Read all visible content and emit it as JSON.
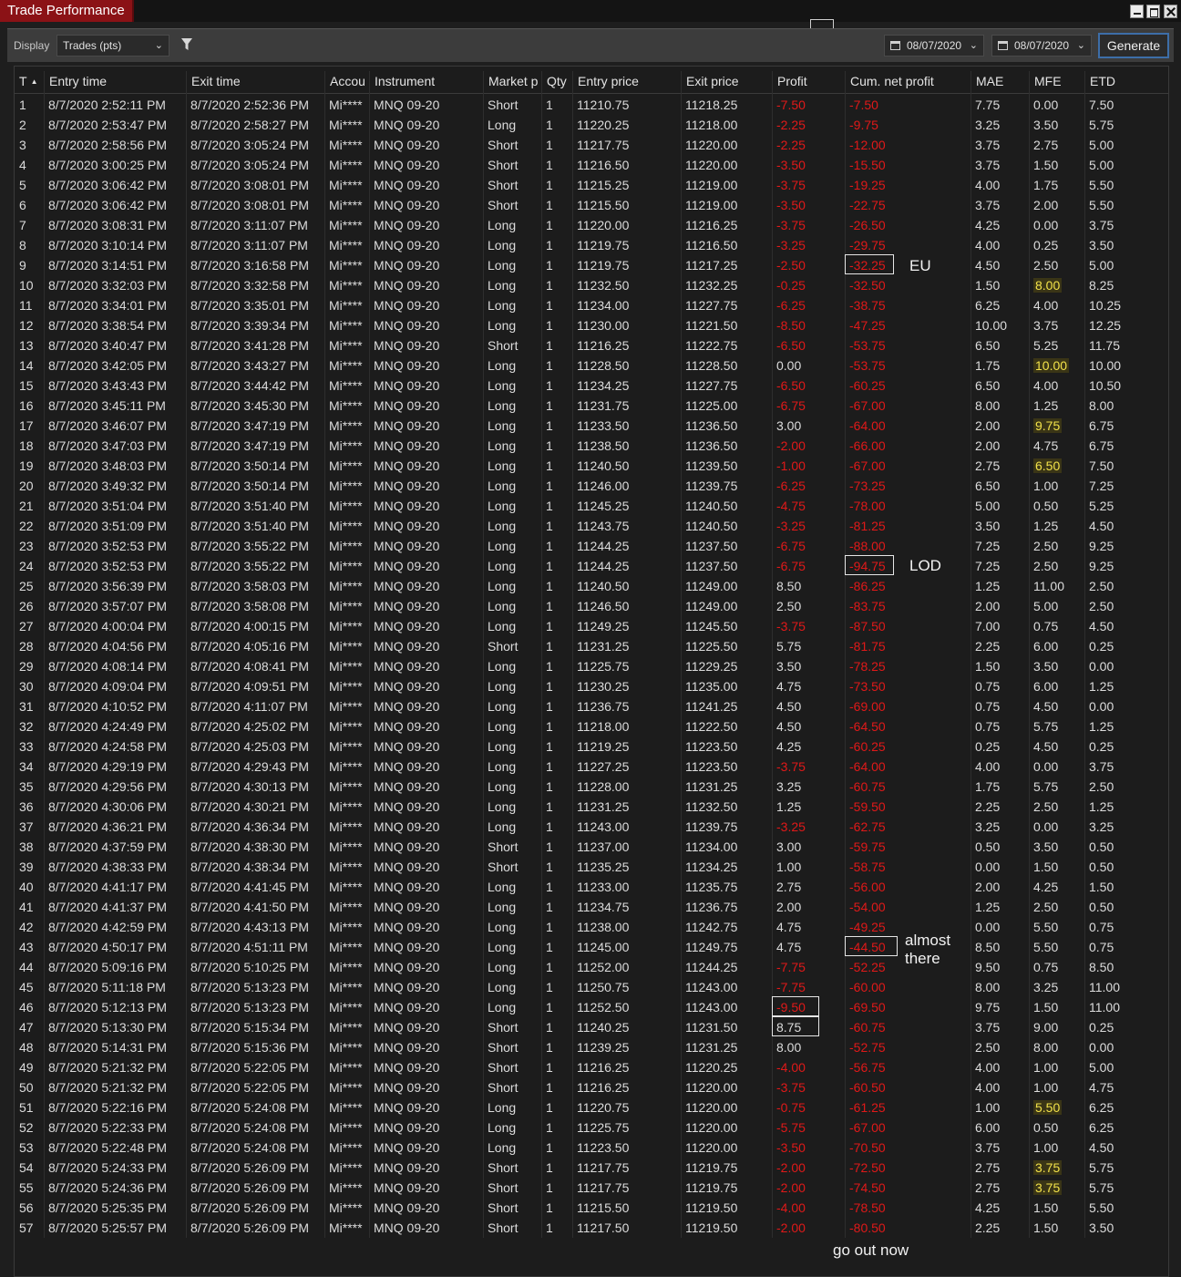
{
  "window": {
    "title": "Trade Performance"
  },
  "toolbar": {
    "display_label": "Display",
    "display_value": "Trades (pts)",
    "from_date": "08/07/2020",
    "to_date": "08/07/2020",
    "generate_label": "Generate"
  },
  "columns": [
    "T",
    "Entry time",
    "Exit time",
    "Accou",
    "Instrument",
    "Market p",
    "Qty",
    "Entry price",
    "Exit price",
    "Profit",
    "Cum. net profit",
    "MAE",
    "MFE",
    "ETD"
  ],
  "rows": [
    [
      "1",
      "8/7/2020 2:52:11 PM",
      "8/7/2020 2:52:36 PM",
      "Mi****",
      "MNQ 09-20",
      "Short",
      "1",
      "11210.75",
      "11218.25",
      "-7.50",
      "-7.50",
      "7.75",
      "0.00",
      "7.50"
    ],
    [
      "2",
      "8/7/2020 2:53:47 PM",
      "8/7/2020 2:58:27 PM",
      "Mi****",
      "MNQ 09-20",
      "Long",
      "1",
      "11220.25",
      "11218.00",
      "-2.25",
      "-9.75",
      "3.25",
      "3.50",
      "5.75"
    ],
    [
      "3",
      "8/7/2020 2:58:56 PM",
      "8/7/2020 3:05:24 PM",
      "Mi****",
      "MNQ 09-20",
      "Short",
      "1",
      "11217.75",
      "11220.00",
      "-2.25",
      "-12.00",
      "3.75",
      "2.75",
      "5.00"
    ],
    [
      "4",
      "8/7/2020 3:00:25 PM",
      "8/7/2020 3:05:24 PM",
      "Mi****",
      "MNQ 09-20",
      "Short",
      "1",
      "11216.50",
      "11220.00",
      "-3.50",
      "-15.50",
      "3.75",
      "1.50",
      "5.00"
    ],
    [
      "5",
      "8/7/2020 3:06:42 PM",
      "8/7/2020 3:08:01 PM",
      "Mi****",
      "MNQ 09-20",
      "Short",
      "1",
      "11215.25",
      "11219.00",
      "-3.75",
      "-19.25",
      "4.00",
      "1.75",
      "5.50"
    ],
    [
      "6",
      "8/7/2020 3:06:42 PM",
      "8/7/2020 3:08:01 PM",
      "Mi****",
      "MNQ 09-20",
      "Short",
      "1",
      "11215.50",
      "11219.00",
      "-3.50",
      "-22.75",
      "3.75",
      "2.00",
      "5.50"
    ],
    [
      "7",
      "8/7/2020 3:08:31 PM",
      "8/7/2020 3:11:07 PM",
      "Mi****",
      "MNQ 09-20",
      "Long",
      "1",
      "11220.00",
      "11216.25",
      "-3.75",
      "-26.50",
      "4.25",
      "0.00",
      "3.75"
    ],
    [
      "8",
      "8/7/2020 3:10:14 PM",
      "8/7/2020 3:11:07 PM",
      "Mi****",
      "MNQ 09-20",
      "Long",
      "1",
      "11219.75",
      "11216.50",
      "-3.25",
      "-29.75",
      "4.00",
      "0.25",
      "3.50"
    ],
    [
      "9",
      "8/7/2020 3:14:51 PM",
      "8/7/2020 3:16:58 PM",
      "Mi****",
      "MNQ 09-20",
      "Long",
      "1",
      "11219.75",
      "11217.25",
      "-2.50",
      "-32.25",
      "4.50",
      "2.50",
      "5.00"
    ],
    [
      "10",
      "8/7/2020 3:32:03 PM",
      "8/7/2020 3:32:58 PM",
      "Mi****",
      "MNQ 09-20",
      "Long",
      "1",
      "11232.50",
      "11232.25",
      "-0.25",
      "-32.50",
      "1.50",
      "8.00",
      "8.25"
    ],
    [
      "11",
      "8/7/2020 3:34:01 PM",
      "8/7/2020 3:35:01 PM",
      "Mi****",
      "MNQ 09-20",
      "Long",
      "1",
      "11234.00",
      "11227.75",
      "-6.25",
      "-38.75",
      "6.25",
      "4.00",
      "10.25"
    ],
    [
      "12",
      "8/7/2020 3:38:54 PM",
      "8/7/2020 3:39:34 PM",
      "Mi****",
      "MNQ 09-20",
      "Long",
      "1",
      "11230.00",
      "11221.50",
      "-8.50",
      "-47.25",
      "10.00",
      "3.75",
      "12.25"
    ],
    [
      "13",
      "8/7/2020 3:40:47 PM",
      "8/7/2020 3:41:28 PM",
      "Mi****",
      "MNQ 09-20",
      "Short",
      "1",
      "11216.25",
      "11222.75",
      "-6.50",
      "-53.75",
      "6.50",
      "5.25",
      "11.75"
    ],
    [
      "14",
      "8/7/2020 3:42:05 PM",
      "8/7/2020 3:43:27 PM",
      "Mi****",
      "MNQ 09-20",
      "Long",
      "1",
      "11228.50",
      "11228.50",
      "0.00",
      "-53.75",
      "1.75",
      "10.00",
      "10.00"
    ],
    [
      "15",
      "8/7/2020 3:43:43 PM",
      "8/7/2020 3:44:42 PM",
      "Mi****",
      "MNQ 09-20",
      "Long",
      "1",
      "11234.25",
      "11227.75",
      "-6.50",
      "-60.25",
      "6.50",
      "4.00",
      "10.50"
    ],
    [
      "16",
      "8/7/2020 3:45:11 PM",
      "8/7/2020 3:45:30 PM",
      "Mi****",
      "MNQ 09-20",
      "Long",
      "1",
      "11231.75",
      "11225.00",
      "-6.75",
      "-67.00",
      "8.00",
      "1.25",
      "8.00"
    ],
    [
      "17",
      "8/7/2020 3:46:07 PM",
      "8/7/2020 3:47:19 PM",
      "Mi****",
      "MNQ 09-20",
      "Long",
      "1",
      "11233.50",
      "11236.50",
      "3.00",
      "-64.00",
      "2.00",
      "9.75",
      "6.75"
    ],
    [
      "18",
      "8/7/2020 3:47:03 PM",
      "8/7/2020 3:47:19 PM",
      "Mi****",
      "MNQ 09-20",
      "Long",
      "1",
      "11238.50",
      "11236.50",
      "-2.00",
      "-66.00",
      "2.00",
      "4.75",
      "6.75"
    ],
    [
      "19",
      "8/7/2020 3:48:03 PM",
      "8/7/2020 3:50:14 PM",
      "Mi****",
      "MNQ 09-20",
      "Long",
      "1",
      "11240.50",
      "11239.50",
      "-1.00",
      "-67.00",
      "2.75",
      "6.50",
      "7.50"
    ],
    [
      "20",
      "8/7/2020 3:49:32 PM",
      "8/7/2020 3:50:14 PM",
      "Mi****",
      "MNQ 09-20",
      "Long",
      "1",
      "11246.00",
      "11239.75",
      "-6.25",
      "-73.25",
      "6.50",
      "1.00",
      "7.25"
    ],
    [
      "21",
      "8/7/2020 3:51:04 PM",
      "8/7/2020 3:51:40 PM",
      "Mi****",
      "MNQ 09-20",
      "Long",
      "1",
      "11245.25",
      "11240.50",
      "-4.75",
      "-78.00",
      "5.00",
      "0.50",
      "5.25"
    ],
    [
      "22",
      "8/7/2020 3:51:09 PM",
      "8/7/2020 3:51:40 PM",
      "Mi****",
      "MNQ 09-20",
      "Long",
      "1",
      "11243.75",
      "11240.50",
      "-3.25",
      "-81.25",
      "3.50",
      "1.25",
      "4.50"
    ],
    [
      "23",
      "8/7/2020 3:52:53 PM",
      "8/7/2020 3:55:22 PM",
      "Mi****",
      "MNQ 09-20",
      "Long",
      "1",
      "11244.25",
      "11237.50",
      "-6.75",
      "-88.00",
      "7.25",
      "2.50",
      "9.25"
    ],
    [
      "24",
      "8/7/2020 3:52:53 PM",
      "8/7/2020 3:55:22 PM",
      "Mi****",
      "MNQ 09-20",
      "Long",
      "1",
      "11244.25",
      "11237.50",
      "-6.75",
      "-94.75",
      "7.25",
      "2.50",
      "9.25"
    ],
    [
      "25",
      "8/7/2020 3:56:39 PM",
      "8/7/2020 3:58:03 PM",
      "Mi****",
      "MNQ 09-20",
      "Long",
      "1",
      "11240.50",
      "11249.00",
      "8.50",
      "-86.25",
      "1.25",
      "11.00",
      "2.50"
    ],
    [
      "26",
      "8/7/2020 3:57:07 PM",
      "8/7/2020 3:58:08 PM",
      "Mi****",
      "MNQ 09-20",
      "Long",
      "1",
      "11246.50",
      "11249.00",
      "2.50",
      "-83.75",
      "2.00",
      "5.00",
      "2.50"
    ],
    [
      "27",
      "8/7/2020 4:00:04 PM",
      "8/7/2020 4:00:15 PM",
      "Mi****",
      "MNQ 09-20",
      "Long",
      "1",
      "11249.25",
      "11245.50",
      "-3.75",
      "-87.50",
      "7.00",
      "0.75",
      "4.50"
    ],
    [
      "28",
      "8/7/2020 4:04:56 PM",
      "8/7/2020 4:05:16 PM",
      "Mi****",
      "MNQ 09-20",
      "Short",
      "1",
      "11231.25",
      "11225.50",
      "5.75",
      "-81.75",
      "2.25",
      "6.00",
      "0.25"
    ],
    [
      "29",
      "8/7/2020 4:08:14 PM",
      "8/7/2020 4:08:41 PM",
      "Mi****",
      "MNQ 09-20",
      "Long",
      "1",
      "11225.75",
      "11229.25",
      "3.50",
      "-78.25",
      "1.50",
      "3.50",
      "0.00"
    ],
    [
      "30",
      "8/7/2020 4:09:04 PM",
      "8/7/2020 4:09:51 PM",
      "Mi****",
      "MNQ 09-20",
      "Long",
      "1",
      "11230.25",
      "11235.00",
      "4.75",
      "-73.50",
      "0.75",
      "6.00",
      "1.25"
    ],
    [
      "31",
      "8/7/2020 4:10:52 PM",
      "8/7/2020 4:11:07 PM",
      "Mi****",
      "MNQ 09-20",
      "Long",
      "1",
      "11236.75",
      "11241.25",
      "4.50",
      "-69.00",
      "0.75",
      "4.50",
      "0.00"
    ],
    [
      "32",
      "8/7/2020 4:24:49 PM",
      "8/7/2020 4:25:02 PM",
      "Mi****",
      "MNQ 09-20",
      "Long",
      "1",
      "11218.00",
      "11222.50",
      "4.50",
      "-64.50",
      "0.75",
      "5.75",
      "1.25"
    ],
    [
      "33",
      "8/7/2020 4:24:58 PM",
      "8/7/2020 4:25:03 PM",
      "Mi****",
      "MNQ 09-20",
      "Long",
      "1",
      "11219.25",
      "11223.50",
      "4.25",
      "-60.25",
      "0.25",
      "4.50",
      "0.25"
    ],
    [
      "34",
      "8/7/2020 4:29:19 PM",
      "8/7/2020 4:29:43 PM",
      "Mi****",
      "MNQ 09-20",
      "Long",
      "1",
      "11227.25",
      "11223.50",
      "-3.75",
      "-64.00",
      "4.00",
      "0.00",
      "3.75"
    ],
    [
      "35",
      "8/7/2020 4:29:56 PM",
      "8/7/2020 4:30:13 PM",
      "Mi****",
      "MNQ 09-20",
      "Long",
      "1",
      "11228.00",
      "11231.25",
      "3.25",
      "-60.75",
      "1.75",
      "5.75",
      "2.50"
    ],
    [
      "36",
      "8/7/2020 4:30:06 PM",
      "8/7/2020 4:30:21 PM",
      "Mi****",
      "MNQ 09-20",
      "Long",
      "1",
      "11231.25",
      "11232.50",
      "1.25",
      "-59.50",
      "2.25",
      "2.50",
      "1.25"
    ],
    [
      "37",
      "8/7/2020 4:36:21 PM",
      "8/7/2020 4:36:34 PM",
      "Mi****",
      "MNQ 09-20",
      "Long",
      "1",
      "11243.00",
      "11239.75",
      "-3.25",
      "-62.75",
      "3.25",
      "0.00",
      "3.25"
    ],
    [
      "38",
      "8/7/2020 4:37:59 PM",
      "8/7/2020 4:38:30 PM",
      "Mi****",
      "MNQ 09-20",
      "Short",
      "1",
      "11237.00",
      "11234.00",
      "3.00",
      "-59.75",
      "0.50",
      "3.50",
      "0.50"
    ],
    [
      "39",
      "8/7/2020 4:38:33 PM",
      "8/7/2020 4:38:34 PM",
      "Mi****",
      "MNQ 09-20",
      "Short",
      "1",
      "11235.25",
      "11234.25",
      "1.00",
      "-58.75",
      "0.00",
      "1.50",
      "0.50"
    ],
    [
      "40",
      "8/7/2020 4:41:17 PM",
      "8/7/2020 4:41:45 PM",
      "Mi****",
      "MNQ 09-20",
      "Long",
      "1",
      "11233.00",
      "11235.75",
      "2.75",
      "-56.00",
      "2.00",
      "4.25",
      "1.50"
    ],
    [
      "41",
      "8/7/2020 4:41:37 PM",
      "8/7/2020 4:41:50 PM",
      "Mi****",
      "MNQ 09-20",
      "Long",
      "1",
      "11234.75",
      "11236.75",
      "2.00",
      "-54.00",
      "1.25",
      "2.50",
      "0.50"
    ],
    [
      "42",
      "8/7/2020 4:42:59 PM",
      "8/7/2020 4:43:13 PM",
      "Mi****",
      "MNQ 09-20",
      "Long",
      "1",
      "11238.00",
      "11242.75",
      "4.75",
      "-49.25",
      "0.00",
      "5.50",
      "0.75"
    ],
    [
      "43",
      "8/7/2020 4:50:17 PM",
      "8/7/2020 4:51:11 PM",
      "Mi****",
      "MNQ 09-20",
      "Long",
      "1",
      "11245.00",
      "11249.75",
      "4.75",
      "-44.50",
      "8.50",
      "5.50",
      "0.75"
    ],
    [
      "44",
      "8/7/2020 5:09:16 PM",
      "8/7/2020 5:10:25 PM",
      "Mi****",
      "MNQ 09-20",
      "Long",
      "1",
      "11252.00",
      "11244.25",
      "-7.75",
      "-52.25",
      "9.50",
      "0.75",
      "8.50"
    ],
    [
      "45",
      "8/7/2020 5:11:18 PM",
      "8/7/2020 5:13:23 PM",
      "Mi****",
      "MNQ 09-20",
      "Long",
      "1",
      "11250.75",
      "11243.00",
      "-7.75",
      "-60.00",
      "8.00",
      "3.25",
      "11.00"
    ],
    [
      "46",
      "8/7/2020 5:12:13 PM",
      "8/7/2020 5:13:23 PM",
      "Mi****",
      "MNQ 09-20",
      "Long",
      "1",
      "11252.50",
      "11243.00",
      "-9.50",
      "-69.50",
      "9.75",
      "1.50",
      "11.00"
    ],
    [
      "47",
      "8/7/2020 5:13:30 PM",
      "8/7/2020 5:15:34 PM",
      "Mi****",
      "MNQ 09-20",
      "Short",
      "1",
      "11240.25",
      "11231.50",
      "8.75",
      "-60.75",
      "3.75",
      "9.00",
      "0.25"
    ],
    [
      "48",
      "8/7/2020 5:14:31 PM",
      "8/7/2020 5:15:36 PM",
      "Mi****",
      "MNQ 09-20",
      "Short",
      "1",
      "11239.25",
      "11231.25",
      "8.00",
      "-52.75",
      "2.50",
      "8.00",
      "0.00"
    ],
    [
      "49",
      "8/7/2020 5:21:32 PM",
      "8/7/2020 5:22:05 PM",
      "Mi****",
      "MNQ 09-20",
      "Short",
      "1",
      "11216.25",
      "11220.25",
      "-4.00",
      "-56.75",
      "4.00",
      "1.00",
      "5.00"
    ],
    [
      "50",
      "8/7/2020 5:21:32 PM",
      "8/7/2020 5:22:05 PM",
      "Mi****",
      "MNQ 09-20",
      "Short",
      "1",
      "11216.25",
      "11220.00",
      "-3.75",
      "-60.50",
      "4.00",
      "1.00",
      "4.75"
    ],
    [
      "51",
      "8/7/2020 5:22:16 PM",
      "8/7/2020 5:24:08 PM",
      "Mi****",
      "MNQ 09-20",
      "Long",
      "1",
      "11220.75",
      "11220.00",
      "-0.75",
      "-61.25",
      "1.00",
      "5.50",
      "6.25"
    ],
    [
      "52",
      "8/7/2020 5:22:33 PM",
      "8/7/2020 5:24:08 PM",
      "Mi****",
      "MNQ 09-20",
      "Long",
      "1",
      "11225.75",
      "11220.00",
      "-5.75",
      "-67.00",
      "6.00",
      "0.50",
      "6.25"
    ],
    [
      "53",
      "8/7/2020 5:22:48 PM",
      "8/7/2020 5:24:08 PM",
      "Mi****",
      "MNQ 09-20",
      "Long",
      "1",
      "11223.50",
      "11220.00",
      "-3.50",
      "-70.50",
      "3.75",
      "1.00",
      "4.50"
    ],
    [
      "54",
      "8/7/2020 5:24:33 PM",
      "8/7/2020 5:26:09 PM",
      "Mi****",
      "MNQ 09-20",
      "Short",
      "1",
      "11217.75",
      "11219.75",
      "-2.00",
      "-72.50",
      "2.75",
      "3.75",
      "5.75"
    ],
    [
      "55",
      "8/7/2020 5:24:36 PM",
      "8/7/2020 5:26:09 PM",
      "Mi****",
      "MNQ 09-20",
      "Short",
      "1",
      "11217.75",
      "11219.75",
      "-2.00",
      "-74.50",
      "2.75",
      "3.75",
      "5.75"
    ],
    [
      "56",
      "8/7/2020 5:25:35 PM",
      "8/7/2020 5:26:09 PM",
      "Mi****",
      "MNQ 09-20",
      "Short",
      "1",
      "11215.50",
      "11219.50",
      "-4.00",
      "-78.50",
      "4.25",
      "1.50",
      "5.50"
    ],
    [
      "57",
      "8/7/2020 5:25:57 PM",
      "8/7/2020 5:26:09 PM",
      "Mi****",
      "MNQ 09-20",
      "Short",
      "1",
      "11217.50",
      "11219.50",
      "-2.00",
      "-80.50",
      "2.25",
      "1.50",
      "3.50"
    ]
  ],
  "highlighted_mfe_rows": [
    10,
    14,
    17,
    19,
    51,
    54,
    55
  ],
  "annotations": {
    "eu": "EU",
    "lod": "LOD",
    "almost_there_1": "almost",
    "almost_there_2": "there",
    "go_out_now": "go out now"
  },
  "colors": {
    "negative": "#e01919",
    "title_tab": "#8b1216",
    "mfe_highlight": "#f2e24a",
    "generate_border": "#3d6ea8"
  }
}
